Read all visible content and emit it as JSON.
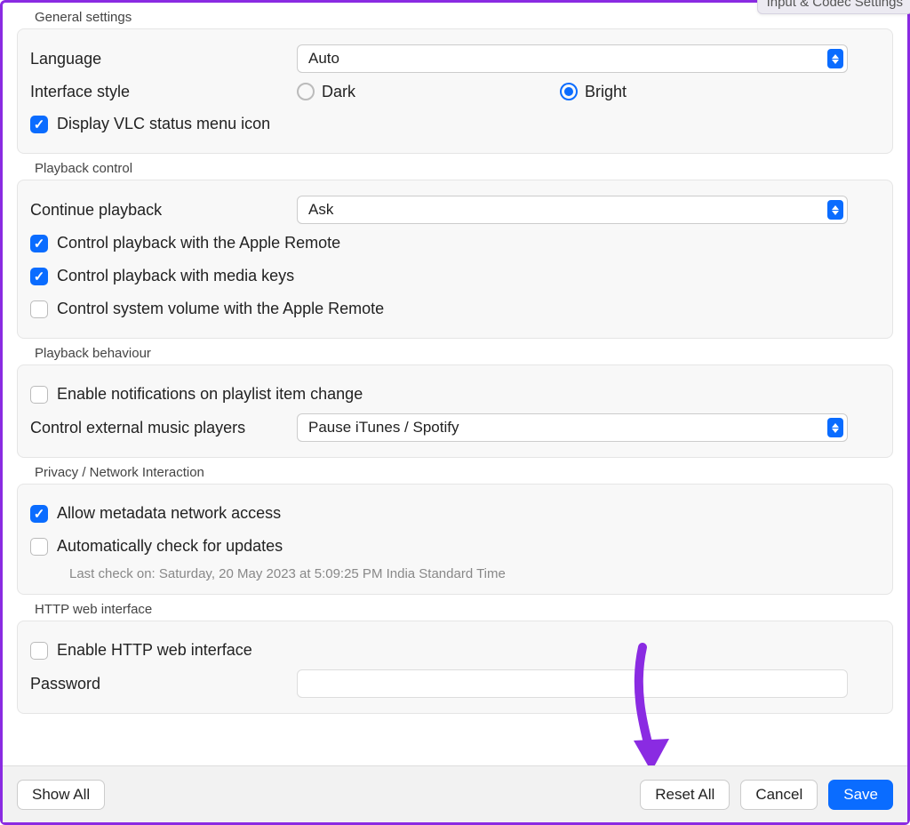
{
  "tabHint": "Input & Codec Settings",
  "general": {
    "title": "General settings",
    "language": {
      "label": "Language",
      "value": "Auto"
    },
    "interfaceStyle": {
      "label": "Interface style",
      "options": {
        "dark": "Dark",
        "bright": "Bright"
      },
      "selected": "bright"
    },
    "statusIcon": {
      "label": "Display VLC status menu icon",
      "checked": true
    }
  },
  "playbackControl": {
    "title": "Playback control",
    "continue": {
      "label": "Continue playback",
      "value": "Ask"
    },
    "appleRemote": {
      "label": "Control playback with the Apple Remote",
      "checked": true
    },
    "mediaKeys": {
      "label": "Control playback with media keys",
      "checked": true
    },
    "systemVolume": {
      "label": "Control system volume with the Apple Remote",
      "checked": false
    }
  },
  "playbackBehaviour": {
    "title": "Playback behaviour",
    "notifications": {
      "label": "Enable notifications on playlist item change",
      "checked": false
    },
    "externalPlayers": {
      "label": "Control external music players",
      "value": "Pause iTunes / Spotify"
    }
  },
  "privacy": {
    "title": "Privacy / Network Interaction",
    "metadata": {
      "label": "Allow metadata network access",
      "checked": true
    },
    "updates": {
      "label": "Automatically check for updates",
      "checked": false
    },
    "lastCheck": "Last check on: Saturday, 20 May 2023 at 5:09:25 PM India Standard Time"
  },
  "http": {
    "title": "HTTP web interface",
    "enable": {
      "label": "Enable HTTP web interface",
      "checked": false
    },
    "password": {
      "label": "Password",
      "value": ""
    }
  },
  "footer": {
    "showAll": "Show All",
    "resetAll": "Reset All",
    "cancel": "Cancel",
    "save": "Save"
  }
}
